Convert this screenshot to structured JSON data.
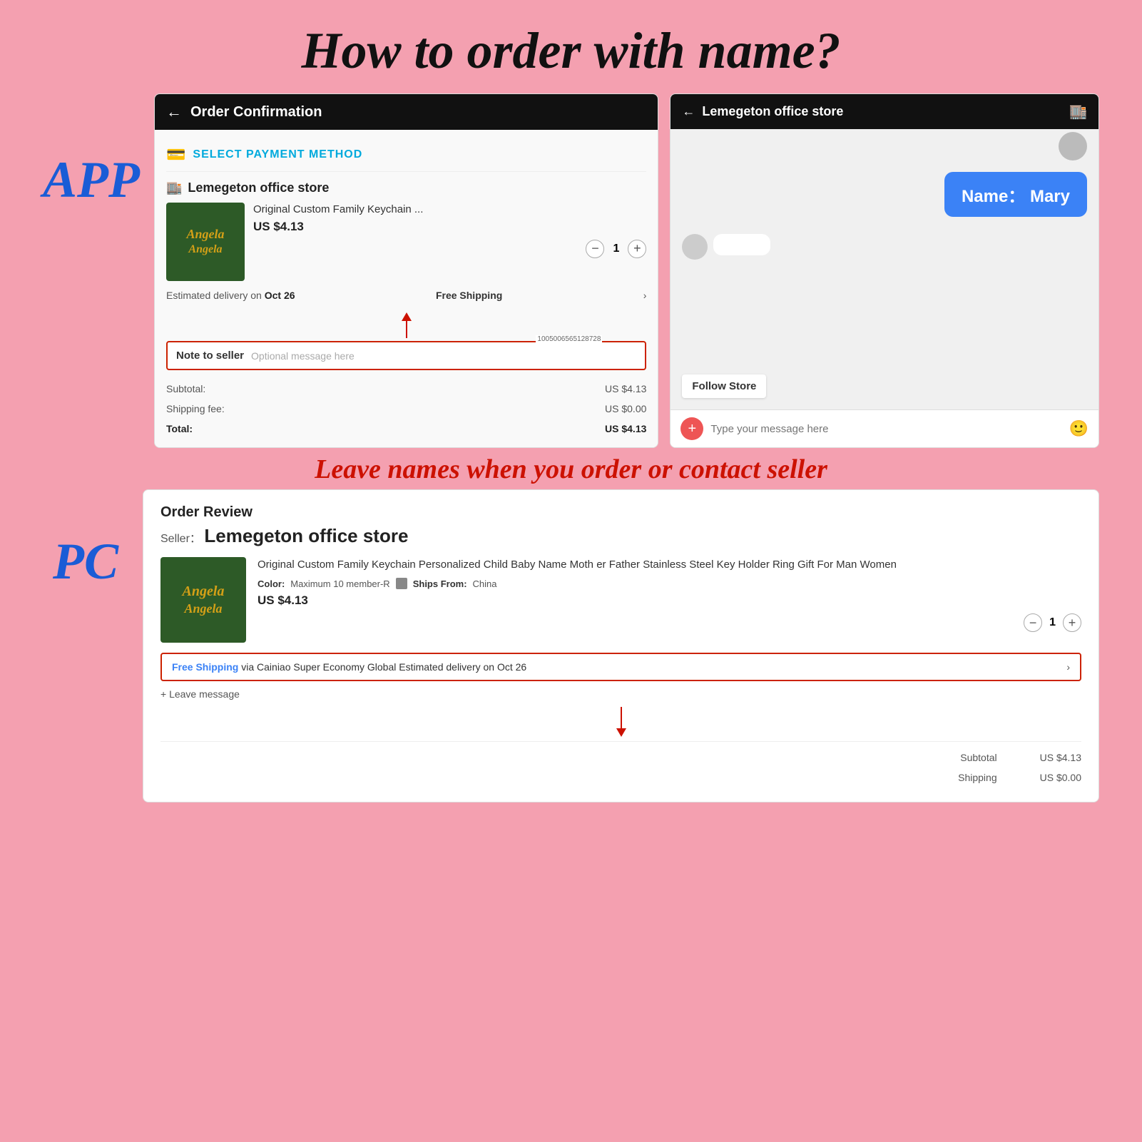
{
  "page": {
    "title": "How to order with name?",
    "instruction": "Leave names when you order or contact seller",
    "app_label": "APP",
    "pc_label": "PC"
  },
  "app_left": {
    "header_title": "Order Confirmation",
    "payment_text": "SELECT PAYMENT METHOD",
    "store_name": "Lemegeton office store",
    "product_title": "Original Custom Family Keychain ...",
    "product_price": "US $4.13",
    "quantity": "1",
    "delivery_text": "Estimated delivery on Oct 26",
    "free_shipping": "Free Shipping",
    "note_label": "Note to seller",
    "note_placeholder": "Optional message here",
    "note_id": "1005006565128728",
    "subtotal_label": "Subtotal:",
    "subtotal_value": "US $4.13",
    "shipping_label": "Shipping fee:",
    "shipping_value": "US $0.00",
    "total_label": "Total:",
    "total_value": "US $4.13",
    "product_name_art": "Angela\nAngela"
  },
  "app_right": {
    "header_title": "Lemegeton office store",
    "chat_bubble": "Name：  Mary",
    "follow_store": "Follow Store",
    "message_placeholder": "Type your message here"
  },
  "pc_section": {
    "order_review_title": "Order Review",
    "seller_prefix": "Seller：",
    "seller_name": "Lemegeton office store",
    "product_title": "Original Custom Family Keychain Personalized Child Baby Name Moth\ner Father Stainless Steel Key Holder Ring Gift For Man Women",
    "color_label": "Color:",
    "color_value": "Maximum 10 member-R",
    "ships_from_label": "Ships From:",
    "ships_from_value": "China",
    "price": "US $4.13",
    "quantity": "1",
    "shipping_text_blue": "Free Shipping",
    "shipping_via": " via Cainiao Super Economy Global  Estimated delivery on Oct 26",
    "leave_message": "+ Leave message",
    "subtotal_label": "Subtotal",
    "subtotal_value": "US $4.13",
    "shipping_label": "Shipping",
    "shipping_value": "US $0.00",
    "product_name_art": "Angela\nAngela"
  }
}
